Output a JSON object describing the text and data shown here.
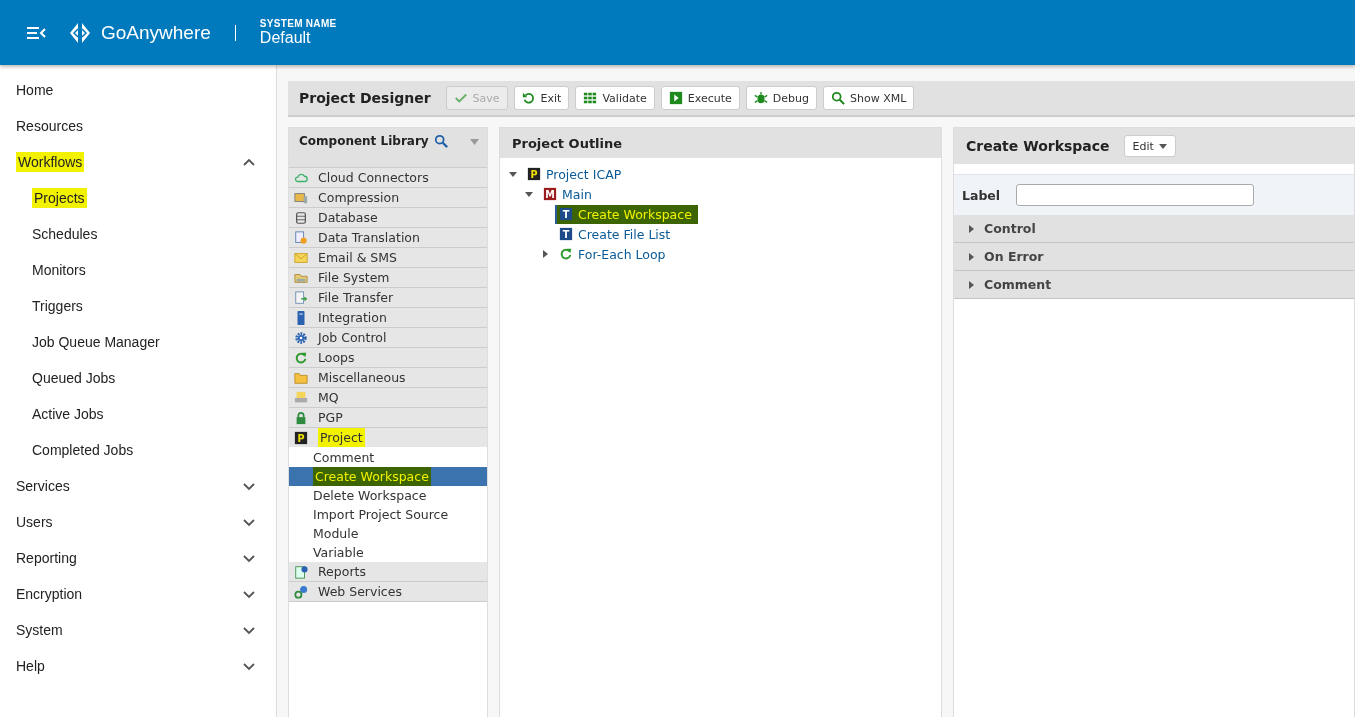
{
  "header": {
    "brand": "GoAnywhere",
    "system_label": "SYSTEM NAME",
    "system_name": "Default"
  },
  "sidebar": {
    "items": [
      {
        "label": "Home",
        "kind": "link",
        "highlighted": false
      },
      {
        "label": "Resources",
        "kind": "link",
        "highlighted": false
      },
      {
        "label": "Workflows",
        "kind": "group",
        "expanded": true,
        "highlighted": true,
        "children": [
          {
            "label": "Projects",
            "highlighted": true
          },
          {
            "label": "Schedules",
            "highlighted": false
          },
          {
            "label": "Monitors",
            "highlighted": false
          },
          {
            "label": "Triggers",
            "highlighted": false
          },
          {
            "label": "Job Queue Manager",
            "highlighted": false
          },
          {
            "label": "Queued Jobs",
            "highlighted": false
          },
          {
            "label": "Active Jobs",
            "highlighted": false
          },
          {
            "label": "Completed Jobs",
            "highlighted": false
          }
        ]
      },
      {
        "label": "Services",
        "kind": "group",
        "expanded": false,
        "highlighted": false
      },
      {
        "label": "Users",
        "kind": "group",
        "expanded": false,
        "highlighted": false
      },
      {
        "label": "Reporting",
        "kind": "group",
        "expanded": false,
        "highlighted": false
      },
      {
        "label": "Encryption",
        "kind": "group",
        "expanded": false,
        "highlighted": false
      },
      {
        "label": "System",
        "kind": "group",
        "expanded": false,
        "highlighted": false
      },
      {
        "label": "Help",
        "kind": "group",
        "expanded": false,
        "highlighted": false
      }
    ]
  },
  "toolbar": {
    "title": "Project Designer",
    "buttons": [
      {
        "label": "Save",
        "disabled": true
      },
      {
        "label": "Exit",
        "disabled": false
      },
      {
        "label": "Validate",
        "disabled": false
      },
      {
        "label": "Execute",
        "disabled": false
      },
      {
        "label": "Debug",
        "disabled": false
      },
      {
        "label": "Show XML",
        "disabled": false
      }
    ]
  },
  "library": {
    "title": "Component Library",
    "categories": [
      {
        "label": "Cloud Connectors",
        "highlighted": false
      },
      {
        "label": "Compression",
        "highlighted": false
      },
      {
        "label": "Database",
        "highlighted": false
      },
      {
        "label": "Data Translation",
        "highlighted": false
      },
      {
        "label": "Email & SMS",
        "highlighted": false
      },
      {
        "label": "File System",
        "highlighted": false
      },
      {
        "label": "File Transfer",
        "highlighted": false
      },
      {
        "label": "Integration",
        "highlighted": false
      },
      {
        "label": "Job Control",
        "highlighted": false
      },
      {
        "label": "Loops",
        "highlighted": false
      },
      {
        "label": "Miscellaneous",
        "highlighted": false
      },
      {
        "label": "MQ",
        "highlighted": false
      },
      {
        "label": "PGP",
        "highlighted": false
      },
      {
        "label": "Project",
        "badge": "P",
        "expanded": true,
        "highlighted": true,
        "children": [
          {
            "label": "Comment",
            "selected": false,
            "highlighted": false
          },
          {
            "label": "Create Workspace",
            "selected": true,
            "highlighted": true
          },
          {
            "label": "Delete Workspace",
            "selected": false,
            "highlighted": false
          },
          {
            "label": "Import Project Source",
            "selected": false,
            "highlighted": false
          },
          {
            "label": "Module",
            "selected": false,
            "highlighted": false
          },
          {
            "label": "Variable",
            "selected": false,
            "highlighted": false
          }
        ]
      },
      {
        "label": "Reports",
        "highlighted": false
      },
      {
        "label": "Web Services",
        "highlighted": false
      }
    ]
  },
  "outline": {
    "title": "Project Outline",
    "tree": [
      {
        "label": "Project ICAP",
        "badge": "P",
        "expanded": true,
        "selected": false,
        "highlighted": false,
        "children": [
          {
            "label": "Main",
            "badge": "M",
            "expanded": true,
            "selected": false,
            "highlighted": false,
            "children": [
              {
                "label": "Create Workspace",
                "badge": "T",
                "selected": true,
                "highlighted": true
              },
              {
                "label": "Create File List",
                "badge": "T",
                "selected": false,
                "highlighted": false
              },
              {
                "label": "For-Each Loop",
                "expanded": false,
                "selected": false,
                "highlighted": false
              }
            ]
          }
        ]
      }
    ]
  },
  "properties": {
    "title": "Create Workspace",
    "edit_button": "Edit",
    "label_field": {
      "label": "Label"
    },
    "sections": [
      {
        "label": "Control",
        "expanded": false
      },
      {
        "label": "On Error",
        "expanded": false
      },
      {
        "label": "Comment",
        "expanded": false
      }
    ]
  }
}
